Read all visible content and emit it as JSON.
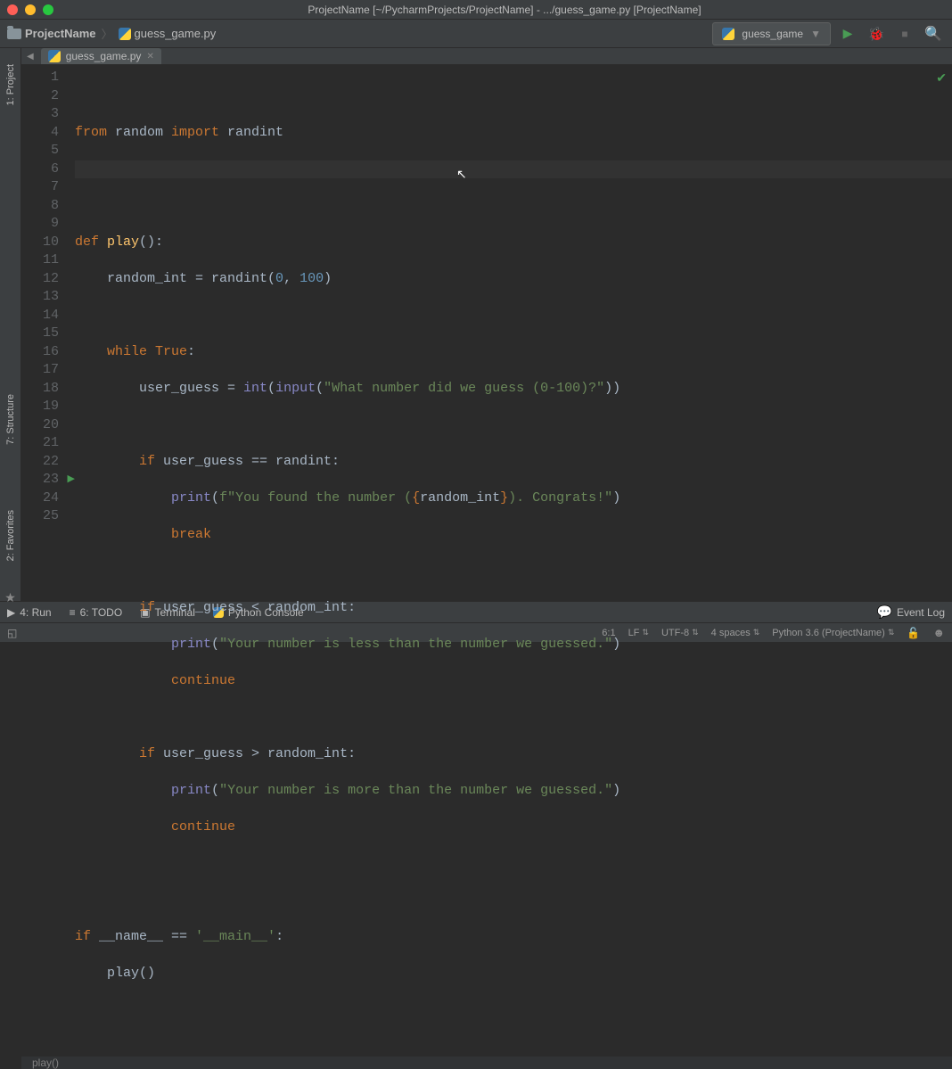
{
  "titlebar": {
    "title": "ProjectName [~/PycharmProjects/ProjectName] - .../guess_game.py [ProjectName]"
  },
  "breadcrumb": {
    "project": "ProjectName",
    "file": "guess_game.py"
  },
  "run_config": {
    "label": "guess_game"
  },
  "side_tabs": {
    "project": "1: Project",
    "structure": "7: Structure",
    "favorites": "2: Favorites"
  },
  "file_tab": {
    "name": "guess_game.py"
  },
  "code": {
    "l1_a": "from",
    "l1_b": " random ",
    "l1_c": "import",
    "l1_d": " randint",
    "l4_a": "def ",
    "l4_b": "play",
    "l4_c": "():",
    "l5_a": "    random_int = randint(",
    "l5_b": "0",
    "l5_c": ", ",
    "l5_d": "100",
    "l5_e": ")",
    "l7_a": "    ",
    "l7_b": "while True",
    "l7_c": ":",
    "l8_a": "        user_guess = ",
    "l8_b": "int",
    "l8_c": "(",
    "l8_d": "input",
    "l8_e": "(",
    "l8_f": "\"What number did we guess (0-100)?\"",
    "l8_g": "))",
    "l10_a": "        ",
    "l10_b": "if ",
    "l10_c": "user_guess == randint:",
    "l11_a": "            ",
    "l11_b": "print",
    "l11_c": "(",
    "l11_d": "f\"You found the number (",
    "l11_e": "{",
    "l11_f": "random_int",
    "l11_g": "}",
    "l11_h": "). Congrats!\"",
    "l11_i": ")",
    "l12_a": "            ",
    "l12_b": "break",
    "l14_a": "        ",
    "l14_b": "if ",
    "l14_c": "user_guess < random_int:",
    "l15_a": "            ",
    "l15_b": "print",
    "l15_c": "(",
    "l15_d": "\"Your number is less than the number we guessed.\"",
    "l15_e": ")",
    "l16_a": "            ",
    "l16_b": "continue",
    "l18_a": "        ",
    "l18_b": "if ",
    "l18_c": "user_guess > random_int:",
    "l19_a": "            ",
    "l19_b": "print",
    "l19_c": "(",
    "l19_d": "\"Your number is more than the number we guessed.\"",
    "l19_e": ")",
    "l20_a": "            ",
    "l20_b": "continue",
    "l23_a": "if ",
    "l23_b": "__name__ == ",
    "l23_c": "'__main__'",
    "l23_d": ":",
    "l24_a": "    play()"
  },
  "line_count": 25,
  "editor_footer": "play()",
  "bottom": {
    "run": "4: Run",
    "todo": "6: TODO",
    "terminal": "Terminal",
    "python_console": "Python Console",
    "event_log": "Event Log"
  },
  "status": {
    "pos": "6:1",
    "lf": "LF",
    "enc": "UTF-8",
    "indent": "4 spaces",
    "python": "Python 3.6 (ProjectName)"
  }
}
